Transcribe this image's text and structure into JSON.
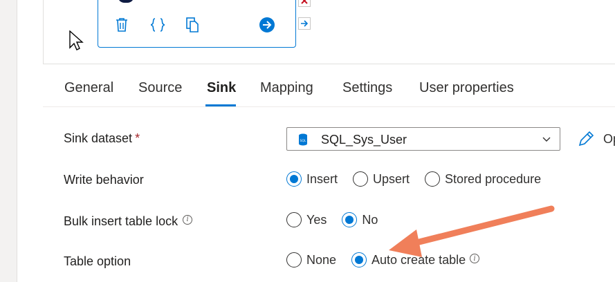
{
  "canvas": {
    "activity_actions": {
      "delete_icon": "trash-icon",
      "code_icon": "braces-icon",
      "clone_icon": "copy-icon",
      "output_icon": "arrow-circle-right-icon"
    }
  },
  "tabs": [
    {
      "label": "General"
    },
    {
      "label": "Source"
    },
    {
      "label": "Sink",
      "active": true
    },
    {
      "label": "Mapping"
    },
    {
      "label": "Settings"
    },
    {
      "label": "User properties"
    }
  ],
  "form": {
    "sink_dataset": {
      "label": "Sink dataset",
      "required_mark": "*",
      "value": "SQL_Sys_User",
      "dataset_icon_text": "SQL",
      "open_label": "Op"
    },
    "write_behavior": {
      "label": "Write behavior",
      "options": [
        "Insert",
        "Upsert",
        "Stored procedure"
      ],
      "selected": "Insert"
    },
    "bulk_insert_table_lock": {
      "label": "Bulk insert table lock",
      "options": [
        "Yes",
        "No"
      ],
      "selected": "No"
    },
    "table_option": {
      "label": "Table option",
      "options": [
        "None",
        "Auto create table"
      ],
      "selected": "Auto create table"
    }
  },
  "colors": {
    "accent": "#0078d4",
    "arrow": "#f07f5a",
    "danger": "#c50f1f"
  }
}
